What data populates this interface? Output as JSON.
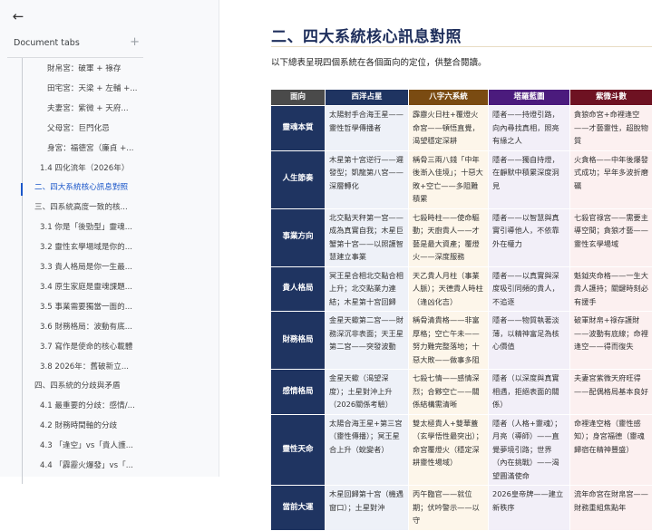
{
  "sidebar": {
    "back_icon": "arrow-left-icon",
    "title": "Document tabs",
    "add_icon": "+",
    "items": [
      {
        "label": "財帛宮：破軍 + 祿存",
        "level": 3
      },
      {
        "label": "田宅宮：天梁 + 左輔 +...",
        "level": 3
      },
      {
        "label": "夫妻宮：紫微 + 天府...",
        "level": 3
      },
      {
        "label": "父母宮：巨門化忌",
        "level": 3
      },
      {
        "label": "身宮：福德宮（廉貞 +...",
        "level": 3
      },
      {
        "label": "1.4 四化流年（2026年）",
        "level": 2
      },
      {
        "label": "二、四大系統核心訊息對照",
        "level": 1,
        "active": true
      },
      {
        "label": "三、四系統高度一致的核...",
        "level": 1
      },
      {
        "label": "3.1 你是「後勁型」靈魂...",
        "level": 2
      },
      {
        "label": "3.2 靈性玄學場域是你的...",
        "level": 2
      },
      {
        "label": "3.3 貴人格局是你一生最...",
        "level": 2
      },
      {
        "label": "3.4 原生家庭是靈魂課題...",
        "level": 2
      },
      {
        "label": "3.5 事業需要獨當一面的...",
        "level": 2
      },
      {
        "label": "3.6 財務格局：波動有底...",
        "level": 2
      },
      {
        "label": "3.7 寫作是使命的核心載體",
        "level": 2
      },
      {
        "label": "3.8 2026年：舊破新立...",
        "level": 2
      },
      {
        "label": "四、四系統的分歧與矛盾",
        "level": 1
      },
      {
        "label": "4.1 最重要的分歧：感情/...",
        "level": 2
      },
      {
        "label": "4.2 財務時間軸的分歧",
        "level": 2
      },
      {
        "label": "4.3 「逢空」vs「貴人護...",
        "level": 2
      },
      {
        "label": "4.4 「霹靂火爆發」vs「...",
        "level": 2
      }
    ]
  },
  "main": {
    "title": "二、四大系統核心訊息對照",
    "intro": "以下總表呈現四個系統在各個面向的定位，供整合閱讀。",
    "table": {
      "headers": [
        "面向",
        "西洋占星",
        "八字六系統",
        "塔羅藍圖",
        "紫微斗數"
      ],
      "header_colors": [
        "#4a4a4a",
        "#1f3461",
        "#7a4b12",
        "#4b1b7d",
        "#6e1222"
      ],
      "rows": [
        [
          "靈魂本質",
          "太陽射手合海王星——靈性哲學傳播者",
          "霹靂火日柱+覆燈火命宮——頓悟直覺，渴望穩定深耕",
          "隱者——持燈引路，向內尋找真相，照亮有緣之人",
          "貪狼命宮+命裡逢空——才藝靈性，超脫物質"
        ],
        [
          "人生節奏",
          "木星第十宮逆行——遲發型；凱龍第八宮——深層轉化",
          "稱骨三兩八錢「中年後漸入佳境」；十惡大敗+空亡——多阻難積累",
          "隱者——獨自持燈，在靜默中積累深度洞見",
          "火貪格——中年後爆發式成功；早年多波折磨礪"
        ],
        [
          "事業方向",
          "北交點天秤第一宮——成為真實自我；木星巨蟹第十宮——以照護智慧建立事業",
          "七殺時柱——使命驅動；天廚貴人——才藝是最大資產；覆燈火——深度服務",
          "隱者——以智慧與真實引導他人，不依靠外在權力",
          "七殺官祿宮——需要主導空間；貪狼才藝——靈性玄學場域"
        ],
        [
          "貴人格局",
          "冥王星合相北交點合相上升；北交點業力連結；木星第十宮回歸",
          "天乙貴人月柱（事業人脈）；天德貴人時柱（逢凶化吉）",
          "隱者——以真實與深度吸引同頻的貴人，不追逐",
          "魁鉞夾命格——一生大貴人護持；關鍵時刻必有援手"
        ],
        [
          "財務格局",
          "金星天蠍第二宮——財務深沉非表面；天王星第二宮——突發波動",
          "稱骨清貴格——非富厚格；空亡午未——努力難完整落地；十惡大敗——做事多阻",
          "隱者——物質執著淡薄，以精神富足為核心價值",
          "破軍財帛+祿存護財——波動有底線；命裡逢空——得而復失"
        ],
        [
          "感情格局",
          "金星天蠍（渴望深度）；土星對沖上升（2026關係考驗）",
          "七殺七情——感情深烈；合夥空亡——關係結構需清晰",
          "隱者（以深度與真實相遇，拒絕表面的關係）",
          "夫妻宮紫微天府旺得——配偶格局基本良好"
        ],
        [
          "靈性天命",
          "太陽合海王星+第三宮（靈性傳播）；冥王星合上升（蛻變者）",
          "雙太極貴人+雙華蓋（玄學悟性最突出）；命宮覆燈火（穩定深耕靈性場域）",
          "隱者（人格+靈魂）；月亮（導師）——直覺夢境引路；世界（內在挑戰）——渴望圓滿使命",
          "命裡逢空格（靈性感知）；身宮福德（靈魂歸宿在精神豐盛）"
        ],
        [
          "當前大運",
          "木星回歸第十宮（機遇窗口）；土星對沖",
          "丙午臨官——就位期；伏吟警示——以守",
          "2026皇帝牌——建立新秩序",
          "流年命宮在財帛宮——財務重組焦點年"
        ]
      ]
    }
  }
}
